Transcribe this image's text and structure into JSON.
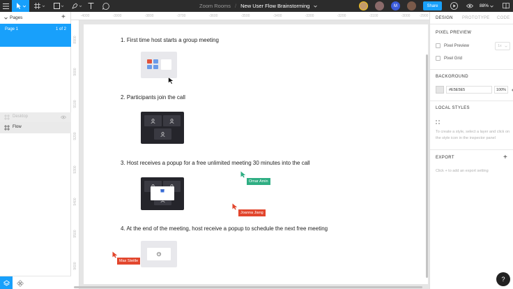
{
  "toolbar": {
    "project": "Zoom Rooms",
    "separator": "/",
    "file_name": "New User Flow Brainstorming",
    "share_label": "Share",
    "zoom_level": "88%",
    "avatar_initial": "M"
  },
  "pages": {
    "header": "Pages",
    "add": "+",
    "current": {
      "name": "Page 1",
      "count": "1 of 2"
    }
  },
  "layers": [
    {
      "name": "Desktop"
    },
    {
      "name": "Flow"
    }
  ],
  "rulers": {
    "top": [
      "-4000",
      "-3900",
      "-3800",
      "-3700",
      "-3600",
      "-3500",
      "-3400",
      "-3300",
      "-3200",
      "-3100",
      "-3000",
      "-2900"
    ],
    "left": [
      "8900",
      "9000",
      "9100",
      "9200",
      "9300",
      "9400",
      "9500",
      "9600"
    ]
  },
  "canvas": {
    "steps": [
      "1. First time host starts a group meeting",
      "2. Participants join the call",
      "3. Host receives a popup for a free unlimited meeting 30 minutes into the call",
      "4. At the end of the meeting, host receive a popup to schedule the next free meeting"
    ],
    "cursors": [
      {
        "name": "Omar Amin",
        "color": "#2fae83"
      },
      {
        "name": "Joanna Jiang",
        "color": "#e2462d"
      },
      {
        "name": "Max Steitle",
        "color": "#e2462d"
      }
    ]
  },
  "inspector": {
    "tabs": [
      "DESIGN",
      "PROTOTYPE",
      "CODE"
    ],
    "pixel_preview": {
      "title": "PIXEL PREVIEW",
      "preview_label": "Pixel Preview",
      "grid_label": "Pixel Grid",
      "scale": "1x"
    },
    "background": {
      "title": "BACKGROUND",
      "hex": "#E5E5E5",
      "opacity": "100%"
    },
    "local_styles": {
      "title": "LOCAL STYLES",
      "hint": "To create a style, select a layer and click on the style icon in the inspector panel"
    },
    "export": {
      "title": "EXPORT",
      "hint": "Click + to add an export setting",
      "add": "+"
    }
  },
  "help": "?",
  "colors": {
    "accent": "#18a0fb",
    "toolbar_bg": "#2c2c2c",
    "canvas_bg": "#e5e5e5"
  }
}
